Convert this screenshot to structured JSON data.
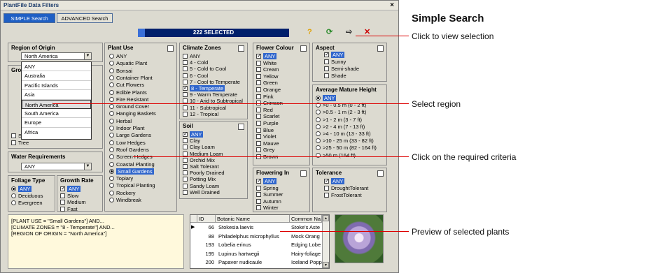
{
  "window": {
    "title": "PlantFile Data Filters",
    "close": "×"
  },
  "tabs": {
    "simple": "SIMPLE Search",
    "advanced": "ADVANCED Search"
  },
  "selected_count": "222 SELECTED",
  "toolbar": {
    "help": "?",
    "refresh": "⟳",
    "view": "⇨",
    "clear": "✕"
  },
  "region": {
    "header": "Region of Origin",
    "value": "North America",
    "options": [
      "ANY",
      "Australia",
      "Pacific Islands",
      "Asia",
      "North America",
      "South America",
      "Europe",
      "Africa"
    ]
  },
  "growth_form": {
    "header": "Gro",
    "partial_items": [
      "Shrub",
      "Tree"
    ]
  },
  "water": {
    "header": "Water Requirements",
    "value": "ANY"
  },
  "foliage": {
    "header": "Foliage Type",
    "items": [
      "ANY",
      "Deciduous",
      "Evergreen"
    ]
  },
  "growth_rate": {
    "header": "Growth Rate",
    "items": [
      "ANY",
      "Slow",
      "Medium",
      "Fast"
    ]
  },
  "plant_use": {
    "header": "Plant Use",
    "items": [
      "ANY",
      "Aquatic Plant",
      "Bonsai",
      "Container Plant",
      "Cut Flowers",
      "Edible Plants",
      "Fire Resistant",
      "Ground Cover",
      "Hanging Baskets",
      "Herbal",
      "Indoor Plant",
      "Large Gardens",
      "Low Hedges",
      "Roof Gardens",
      "Screen Hedges",
      "Coastal Planting",
      "Small Gardens",
      "Topiary",
      "Tropical Planting",
      "Rockery",
      "Windbreak"
    ]
  },
  "climate": {
    "header": "Climate Zones",
    "items": [
      "ANY",
      "4 - Cold",
      "5 - Cold to Cool",
      "6 - Cool",
      "7 - Cool to Temperate",
      "8 - Temperate",
      "9 - Warm Temperate",
      "10 - Arid to Subtropical",
      "11 - Subtropical",
      "12 - Tropical"
    ]
  },
  "soil": {
    "header": "Soil",
    "items": [
      "ANY",
      "Clay",
      "Clay Loam",
      "Medium Loam",
      "Orchid Mix",
      "Salt Tolerant",
      "Poorly Drained",
      "Potting Mix",
      "Sandy Loam",
      "Well Drained"
    ]
  },
  "flower_colour": {
    "header": "Flower Colour",
    "items": [
      "ANY",
      "White",
      "Cream",
      "Yellow",
      "Green",
      "Orange",
      "Pink",
      "Crimson",
      "Red",
      "Scarlet",
      "Purple",
      "Blue",
      "Violet",
      "Mauve",
      "Grey",
      "Brown"
    ]
  },
  "aspect": {
    "header": "Aspect",
    "items": [
      "ANY",
      "Sunny",
      "Semi-shade",
      "Shade"
    ]
  },
  "height": {
    "header": "Average Mature Height",
    "items": [
      "ANY",
      ">0 - 0.5 m (0 - 2 ft)",
      ">0.5 - 1 m (2 - 3 ft)",
      ">1 - 2 m (3 - 7 ft)",
      ">2 - 4 m (7 - 13 ft)",
      ">4 - 10 m (13 - 33 ft)",
      ">10 - 25 m (33 - 82 ft)",
      ">25 - 50 m (82 - 164 ft)",
      ">50 m (164 ft)"
    ]
  },
  "flowering": {
    "header": "Flowering In",
    "items": [
      "ANY",
      "Spring",
      "Summer",
      "Autumn",
      "Winter"
    ]
  },
  "tolerance": {
    "header": "Tolerance",
    "items": [
      "ANY",
      "DroughtTolerant",
      "FrostTolerant"
    ]
  },
  "sql": [
    "[PLANT USE = \"Small Gardens\"] AND...",
    "[CLIMATE ZONES = \"8 - Temperate\"] AND...",
    "[REGION OF ORIGIN = \"North America\"]"
  ],
  "results": {
    "headers": [
      "ID",
      "Botanic Name",
      "Common Na"
    ],
    "rows": [
      [
        "66",
        "Stokesia laevis",
        "Stoke's Aste"
      ],
      [
        "88",
        "Philadelphus microphyllus",
        "Mock Orang"
      ],
      [
        "193",
        "Lobelia erinus",
        "Edging Lobe"
      ],
      [
        "195",
        "Lupinus hartwegii",
        "Hairy-foliage"
      ],
      [
        "200",
        "Papaver nudicaule",
        "Iceland Popp"
      ]
    ]
  },
  "annotations": {
    "title": "Simple Search",
    "view": "Click to view selection",
    "region": "Select region",
    "criteria": "Click on the required criteria",
    "preview": "Preview of selected plants"
  },
  "colors": {
    "selection": "#3066cc",
    "selbar": "#001f6b",
    "callout_line": "#dd0000"
  }
}
